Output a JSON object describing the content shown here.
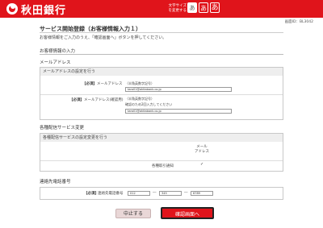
{
  "header": {
    "bank_name": "秋田銀行",
    "font_size_label": "文字サイズを変更する",
    "font_sizes": [
      "あ",
      "あ",
      "あ"
    ]
  },
  "screen_id": "画面ID：BL3042",
  "page": {
    "title": "サービス開始登録（お客様情報入力１）",
    "intro": "お客様情報をご入力のうえ、「確認画面へ」ボタンを押してください。"
  },
  "section_customer": "お客様情報の入力",
  "section_mail": {
    "title": "メールアドレス",
    "box_title": "メールアドレスの設定を行う",
    "required": "【必須】",
    "email_label": "メールアドレス",
    "email_hint": "（半角英数字記号）",
    "email_value": "taro01@akitabank.co.jp",
    "confirm_label": "メールアドレス(確認用)",
    "confirm_hint": "（半角英数字記号）",
    "confirm_note": "確認のため2回入力してください",
    "confirm_value": "taro01@akitabank.co.jp"
  },
  "section_notify": {
    "title": "各種配信サービス変更",
    "box_title": "各種配信サービスの設定変更を行う",
    "column_header": "メール\nアドレス",
    "row_label": "各種取引通知",
    "checked_mark": "✓"
  },
  "section_phone": {
    "title": "連絡先電話番号",
    "required": "【必須】",
    "label": "連絡先電話番号",
    "part1": "012",
    "part2": "345",
    "part3": "6789",
    "separator": "―"
  },
  "buttons": {
    "cancel": "中止する",
    "confirm": "確認画面へ"
  },
  "colors": {
    "brand_red": "#e0141b"
  }
}
